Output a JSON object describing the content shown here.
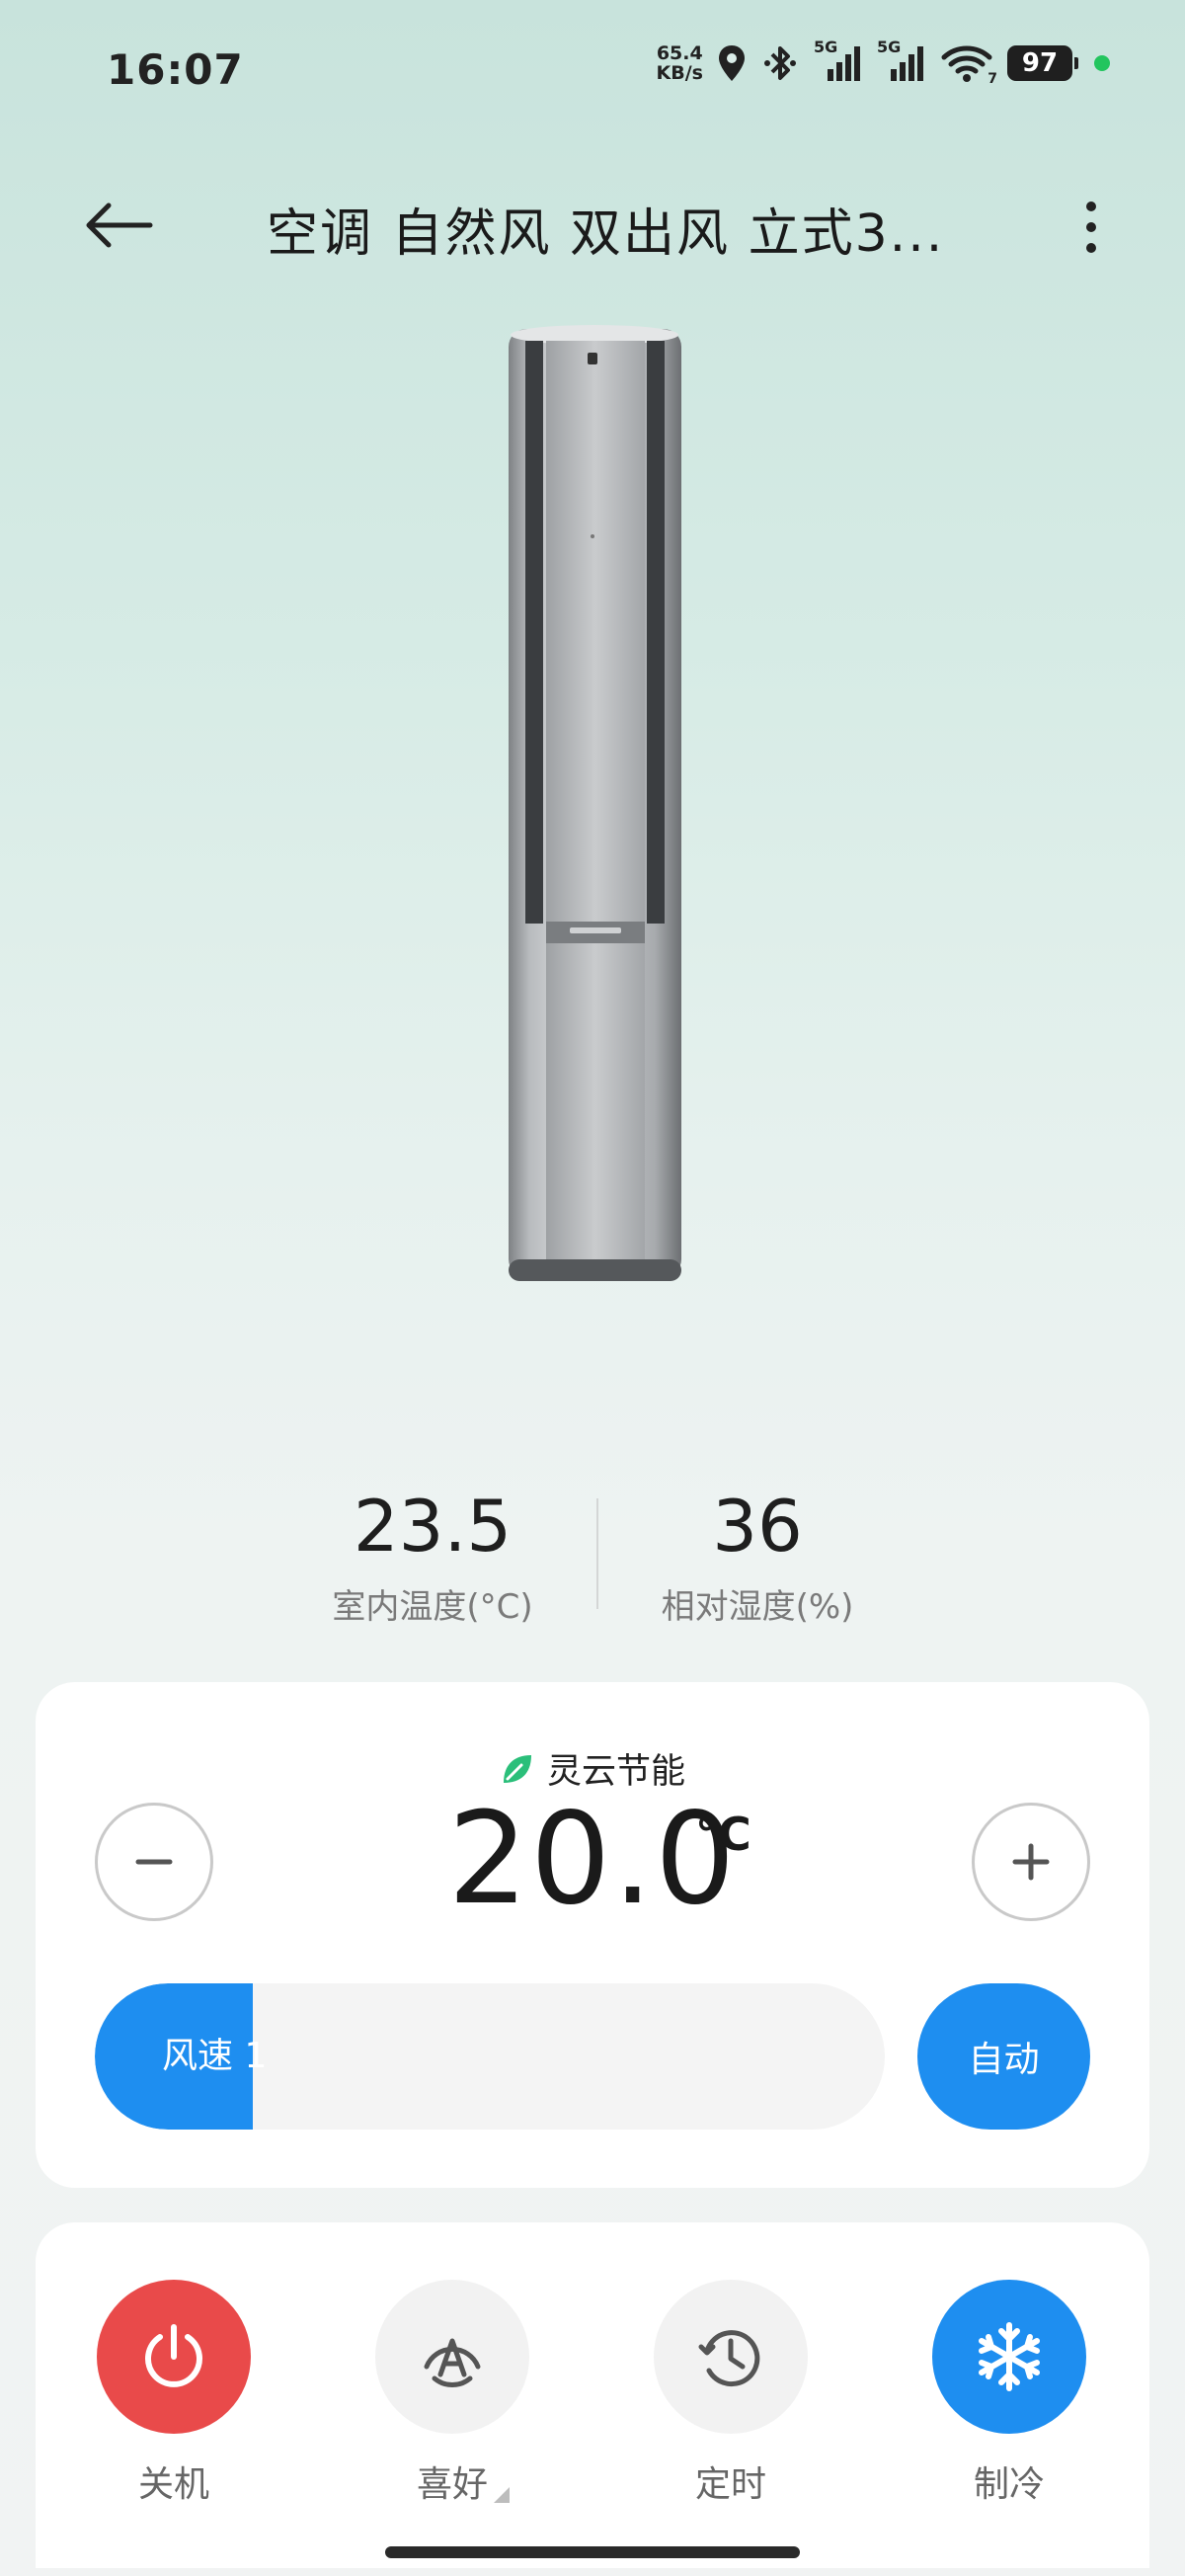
{
  "status_bar": {
    "time": "16:07",
    "net_speed_value": "65.4",
    "net_speed_unit": "KB/s",
    "signal_1_label": "5G",
    "signal_2_label": "5G",
    "wifi_sub": "7",
    "battery": "97",
    "icons": [
      "location-icon",
      "bluetooth-icon",
      "signal-icon",
      "signal-icon",
      "wifi-icon",
      "battery-icon"
    ]
  },
  "header": {
    "title": "空调 自然风 双出风 立式3..."
  },
  "readings": {
    "indoor_temp_value": "23.5",
    "indoor_temp_label": "室内温度(°C)",
    "humidity_value": "36",
    "humidity_label": "相对湿度(%)"
  },
  "control": {
    "eco_label": "灵云节能",
    "target_temp": "20.0",
    "temp_unit": "°C",
    "fan_label": "风速 1",
    "fan_level_fraction": 0.2,
    "auto_label": "自动"
  },
  "modes": [
    {
      "label": "关机",
      "icon": "power-icon",
      "active": true,
      "color": "#e94a4a"
    },
    {
      "label": "喜好",
      "icon": "auto-a-icon",
      "active": false,
      "color": "#f2f2f2"
    },
    {
      "label": "定时",
      "icon": "clock-icon",
      "active": false,
      "color": "#f2f2f2"
    },
    {
      "label": "制冷",
      "icon": "snowflake-icon",
      "active": true,
      "color": "#1e8ef0"
    }
  ],
  "colors": {
    "accent_blue": "#1e8ef0",
    "power_red": "#e94a4a",
    "eco_green": "#2bbf7a"
  }
}
